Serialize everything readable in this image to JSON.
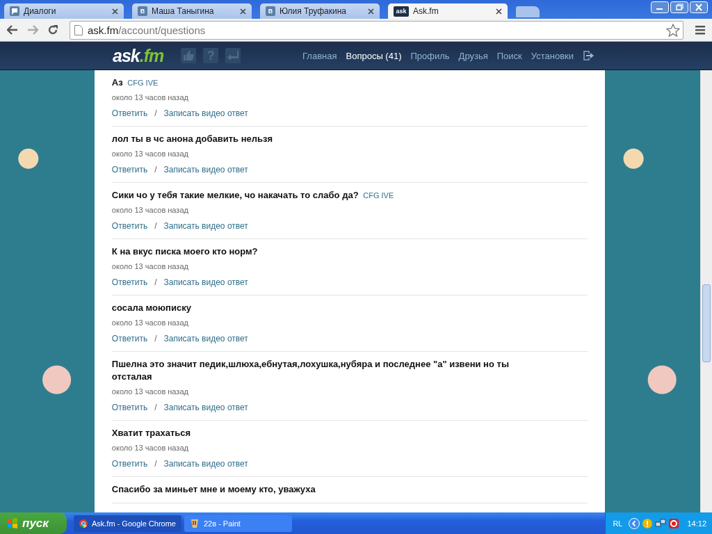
{
  "browser": {
    "tabs": [
      {
        "title": "Диалоги",
        "selected": false,
        "kind": "chat"
      },
      {
        "title": "Маша Таныгина",
        "selected": false,
        "kind": "letter",
        "icon_text": "B"
      },
      {
        "title": "Юлия Труфакина",
        "selected": false,
        "kind": "letter",
        "icon_text": "B"
      },
      {
        "title": "Ask.fm",
        "selected": true,
        "kind": "ask",
        "icon_text": "ask"
      }
    ],
    "address": {
      "host": "ask.fm",
      "path": "/account/questions"
    }
  },
  "header": {
    "logo": {
      "main": "ask",
      "tld": ".fm"
    },
    "icons": [
      {
        "kind": "like"
      },
      {
        "kind": "question",
        "glyph": "?"
      },
      {
        "kind": "reply"
      }
    ],
    "nav": [
      {
        "label": "Главная",
        "selected": false
      },
      {
        "label": "Вопросы (41)",
        "selected": true
      },
      {
        "label": "Профиль",
        "selected": false
      },
      {
        "label": "Друзья",
        "selected": false
      },
      {
        "label": "Поиск",
        "selected": false
      },
      {
        "label": "Установки",
        "selected": false
      }
    ]
  },
  "questions": [
    {
      "text": "Аз",
      "author": "CFG IVE",
      "time": "около 13 часов назад",
      "reply": "Ответить",
      "separator": "/",
      "video": "Записать видео ответ"
    },
    {
      "text": "лол ты в чс анона добавить нельзя",
      "time": "около 13 часов назад",
      "reply": "Ответить",
      "separator": "/",
      "video": "Записать видео ответ"
    },
    {
      "text": "Сики чо у тебя такие мелкие, чо накачать то слабо да?",
      "author": "CFG IVE",
      "time": "около 13 часов назад",
      "reply": "Ответить",
      "separator": "/",
      "video": "Записать видео ответ"
    },
    {
      "text": "К на вкус писка моего кто норм?",
      "time": "около 13 часов назад",
      "reply": "Ответить",
      "separator": "/",
      "video": "Записать видео ответ"
    },
    {
      "text": "сосала моюписку",
      "time": "около 13 часов назад",
      "reply": "Ответить",
      "separator": "/",
      "video": "Записать видео ответ"
    },
    {
      "text": "Пшелна это значит педик,шлюха,ебнутая,лохушка,нубяра и последнее \"а\" извени но ты отсталая",
      "time": "около 13 часов назад",
      "reply": "Ответить",
      "separator": "/",
      "video": "Записать видео ответ"
    },
    {
      "text": "Хватит трахаться",
      "time": "около 13 часов назад",
      "reply": "Ответить",
      "separator": "/",
      "video": "Записать видео ответ"
    },
    {
      "text": "Спасибо за миньет мне и моему кто, уважуха"
    }
  ],
  "taskbar": {
    "start": "пуск",
    "tasks": [
      {
        "label": "Ask.fm - Google Chrome",
        "selected": true,
        "kind": "chrome"
      },
      {
        "label": "22в - Paint",
        "selected": false,
        "kind": "paint"
      }
    ],
    "language": "RL",
    "clock": "14:12"
  }
}
